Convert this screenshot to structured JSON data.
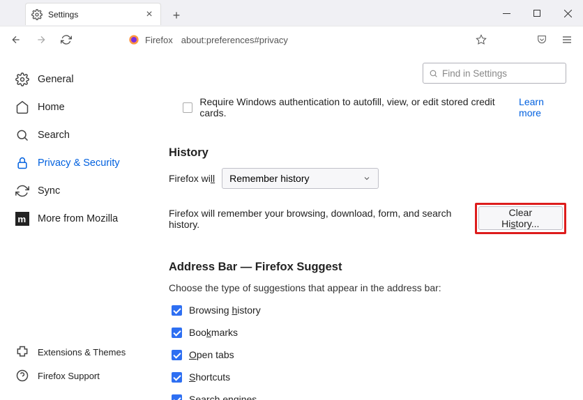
{
  "tab": {
    "title": "Settings"
  },
  "addressbar": {
    "fx": "Firefox",
    "url": "about:preferences#privacy"
  },
  "search": {
    "placeholder": "Find in Settings"
  },
  "sidebar": {
    "items": [
      {
        "label": "General"
      },
      {
        "label": "Home"
      },
      {
        "label": "Search"
      },
      {
        "label": "Privacy & Security"
      },
      {
        "label": "Sync"
      },
      {
        "label": "More from Mozilla"
      }
    ],
    "bottom": [
      {
        "label": "Extensions & Themes"
      },
      {
        "label": "Firefox Support"
      }
    ]
  },
  "winauth": {
    "label_a": "Require Windows authentication to autofill, view, or edit stored credit cards.",
    "learn": "Learn more"
  },
  "history": {
    "heading": "History",
    "fx_will_a": "Firefox wi",
    "fx_will_b": "ll",
    "select": "Remember history",
    "desc": "Firefox will remember your browsing, download, form, and search history.",
    "clear_a": "Clear Hi",
    "clear_b": "s",
    "clear_c": "tory..."
  },
  "addressbar_section": {
    "heading": "Address Bar — Firefox Suggest",
    "sub": "Choose the type of suggestions that appear in the address bar:",
    "items": [
      {
        "a": "Browsing ",
        "u": "h",
        "b": "istory"
      },
      {
        "a": "Boo",
        "u": "k",
        "b": "marks"
      },
      {
        "a": "",
        "u": "O",
        "b": "pen tabs"
      },
      {
        "a": "",
        "u": "S",
        "b": "hortcuts"
      },
      {
        "a": "Search engines",
        "u": "",
        "b": ""
      }
    ]
  }
}
